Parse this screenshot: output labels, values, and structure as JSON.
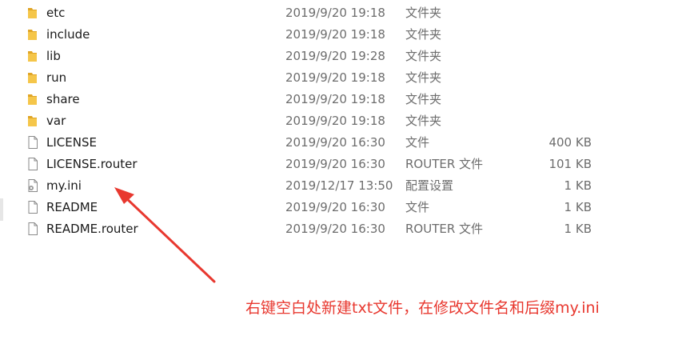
{
  "files": [
    {
      "kind": "folder",
      "icon": "folder-icon",
      "name": "etc",
      "date": "2019/9/20 19:18",
      "type": "文件夹",
      "size": ""
    },
    {
      "kind": "folder",
      "icon": "folder-icon",
      "name": "include",
      "date": "2019/9/20 19:18",
      "type": "文件夹",
      "size": ""
    },
    {
      "kind": "folder",
      "icon": "folder-icon",
      "name": "lib",
      "date": "2019/9/20 19:28",
      "type": "文件夹",
      "size": ""
    },
    {
      "kind": "folder",
      "icon": "folder-icon",
      "name": "run",
      "date": "2019/9/20 19:18",
      "type": "文件夹",
      "size": ""
    },
    {
      "kind": "folder",
      "icon": "folder-icon",
      "name": "share",
      "date": "2019/9/20 19:18",
      "type": "文件夹",
      "size": ""
    },
    {
      "kind": "folder",
      "icon": "folder-icon",
      "name": "var",
      "date": "2019/9/20 19:18",
      "type": "文件夹",
      "size": ""
    },
    {
      "kind": "file",
      "icon": "file-icon",
      "name": "LICENSE",
      "date": "2019/9/20 16:30",
      "type": "文件",
      "size": "400 KB"
    },
    {
      "kind": "file",
      "icon": "file-icon",
      "name": "LICENSE.router",
      "date": "2019/9/20 16:30",
      "type": "ROUTER 文件",
      "size": "101 KB"
    },
    {
      "kind": "config",
      "icon": "settings-file-icon",
      "name": "my.ini",
      "date": "2019/12/17 13:50",
      "type": "配置设置",
      "size": "1 KB"
    },
    {
      "kind": "file",
      "icon": "file-icon",
      "name": "README",
      "date": "2019/9/20 16:30",
      "type": "文件",
      "size": "1 KB"
    },
    {
      "kind": "file",
      "icon": "file-icon",
      "name": "README.router",
      "date": "2019/9/20 16:30",
      "type": "ROUTER 文件",
      "size": "1 KB"
    }
  ],
  "annotation": {
    "text": "右键空白处新建txt文件，在修改文件名和后缀my.ini",
    "color": "#e8382f"
  },
  "colors": {
    "folder": "#f5c64a",
    "folder_dark": "#e0a526",
    "annotation_red": "#e8382f",
    "secondary_text": "#6d6d6d"
  }
}
